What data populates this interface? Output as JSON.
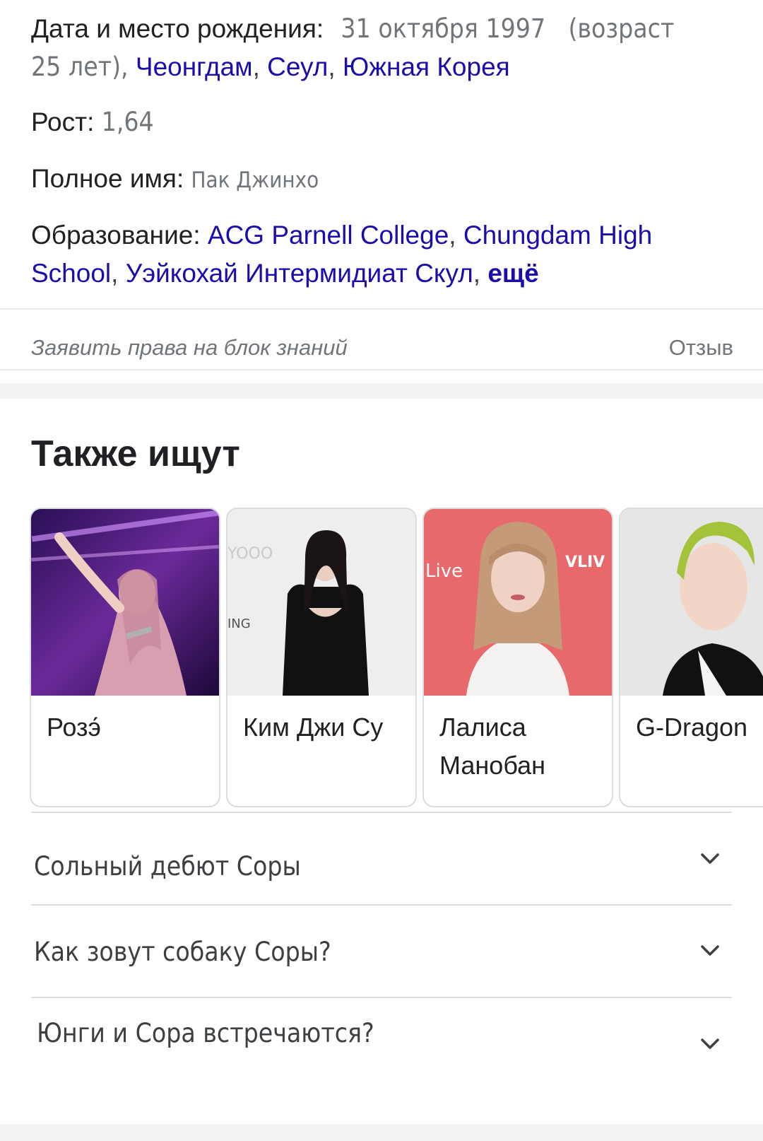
{
  "facts": {
    "birth": {
      "label": "Дата и место рождения:",
      "date": "31 октября 1997",
      "age_open": "(возраст",
      "age_close": "25 лет),",
      "place_parts": [
        "Чеонгдам",
        "Сеул",
        "Южная Корея"
      ]
    },
    "height": {
      "label": "Рост:",
      "value": "1,64"
    },
    "full_name": {
      "label": "Полное имя:",
      "value": "Пак Джинхо"
    },
    "education": {
      "label": "Образование:",
      "items": [
        "ACG Parnell College",
        "Chungdam High School",
        "Уэйкохай Интермидиат Скул"
      ],
      "more": "ещё"
    }
  },
  "footer": {
    "claim": "Заявить права на блок знаний",
    "feedback": "Отзыв"
  },
  "people_also_search": {
    "title": "Также ищут",
    "cards": [
      {
        "name": "Розэ́",
        "photo": "concert-singer-photo"
      },
      {
        "name": "Ким Джи Су",
        "photo": "woman-black-dress-photo"
      },
      {
        "name": "Лалиса Манобан",
        "photo": "woman-bangs-photo"
      },
      {
        "name": "G-Dragon",
        "photo": "man-green-hair-photo"
      }
    ]
  },
  "questions": [
    "Сольный дебют Соры",
    "Как зовут собаку Соры?",
    "Юнги и Сора встречаются?"
  ],
  "colors": {
    "link": "#1a0dab",
    "muted": "#70757a",
    "text": "#202124",
    "border": "#dadce0"
  }
}
